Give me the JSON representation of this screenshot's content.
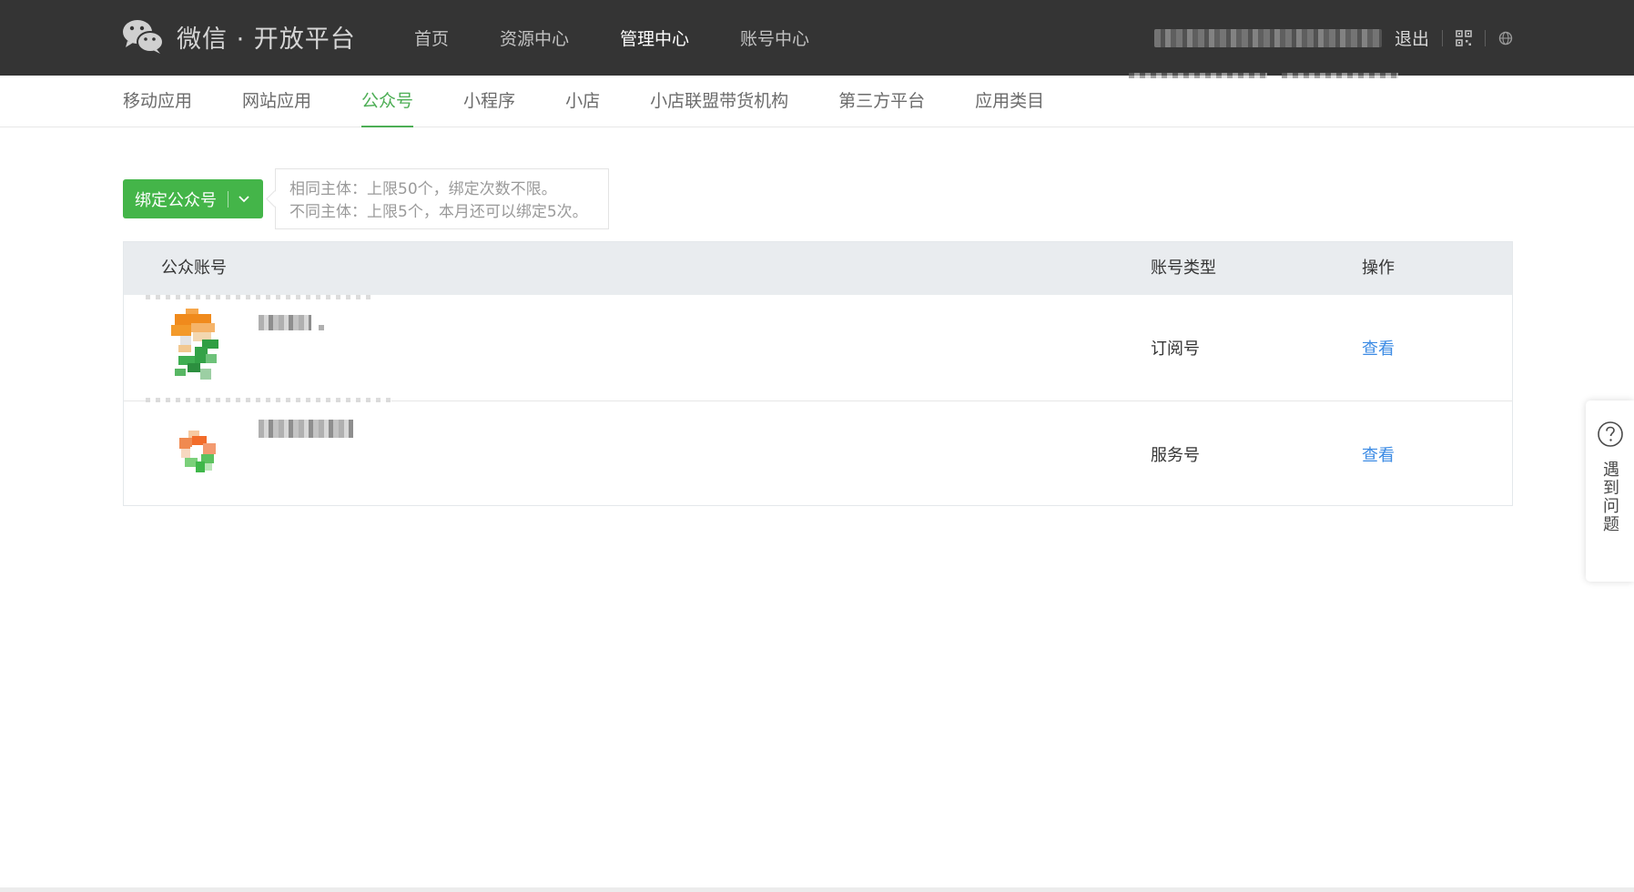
{
  "header": {
    "brand": "微信 · 开放平台",
    "nav": [
      {
        "label": "首页",
        "active": false
      },
      {
        "label": "资源中心",
        "active": false
      },
      {
        "label": "管理中心",
        "active": true
      },
      {
        "label": "账号中心",
        "active": false
      }
    ],
    "logout_label": "退出",
    "icons": [
      "wechat-logo-icon",
      "qrcode-icon",
      "globe-icon"
    ]
  },
  "subnav": {
    "items": [
      {
        "label": "移动应用",
        "active": false
      },
      {
        "label": "网站应用",
        "active": false
      },
      {
        "label": "公众号",
        "active": true
      },
      {
        "label": "小程序",
        "active": false
      },
      {
        "label": "小店",
        "active": false
      },
      {
        "label": "小店联盟带货机构",
        "active": false
      },
      {
        "label": "第三方平台",
        "active": false
      },
      {
        "label": "应用类目",
        "active": false
      }
    ]
  },
  "bind": {
    "button_label": "绑定公众号",
    "tip_lines": [
      "相同主体：上限50个，绑定次数不限。",
      "不同主体：上限5个，本月还可以绑定5次。"
    ]
  },
  "table": {
    "headers": {
      "account": "公众账号",
      "type": "账号类型",
      "action": "操作"
    },
    "rows": [
      {
        "type": "订阅号",
        "action": "查看"
      },
      {
        "type": "服务号",
        "action": "查看"
      }
    ]
  },
  "help": {
    "label": "遇到问题"
  },
  "colors": {
    "topbar": "#343434",
    "accent_green": "#44b549",
    "link_blue": "#3c8be4",
    "table_header_bg": "#e9ecef"
  }
}
